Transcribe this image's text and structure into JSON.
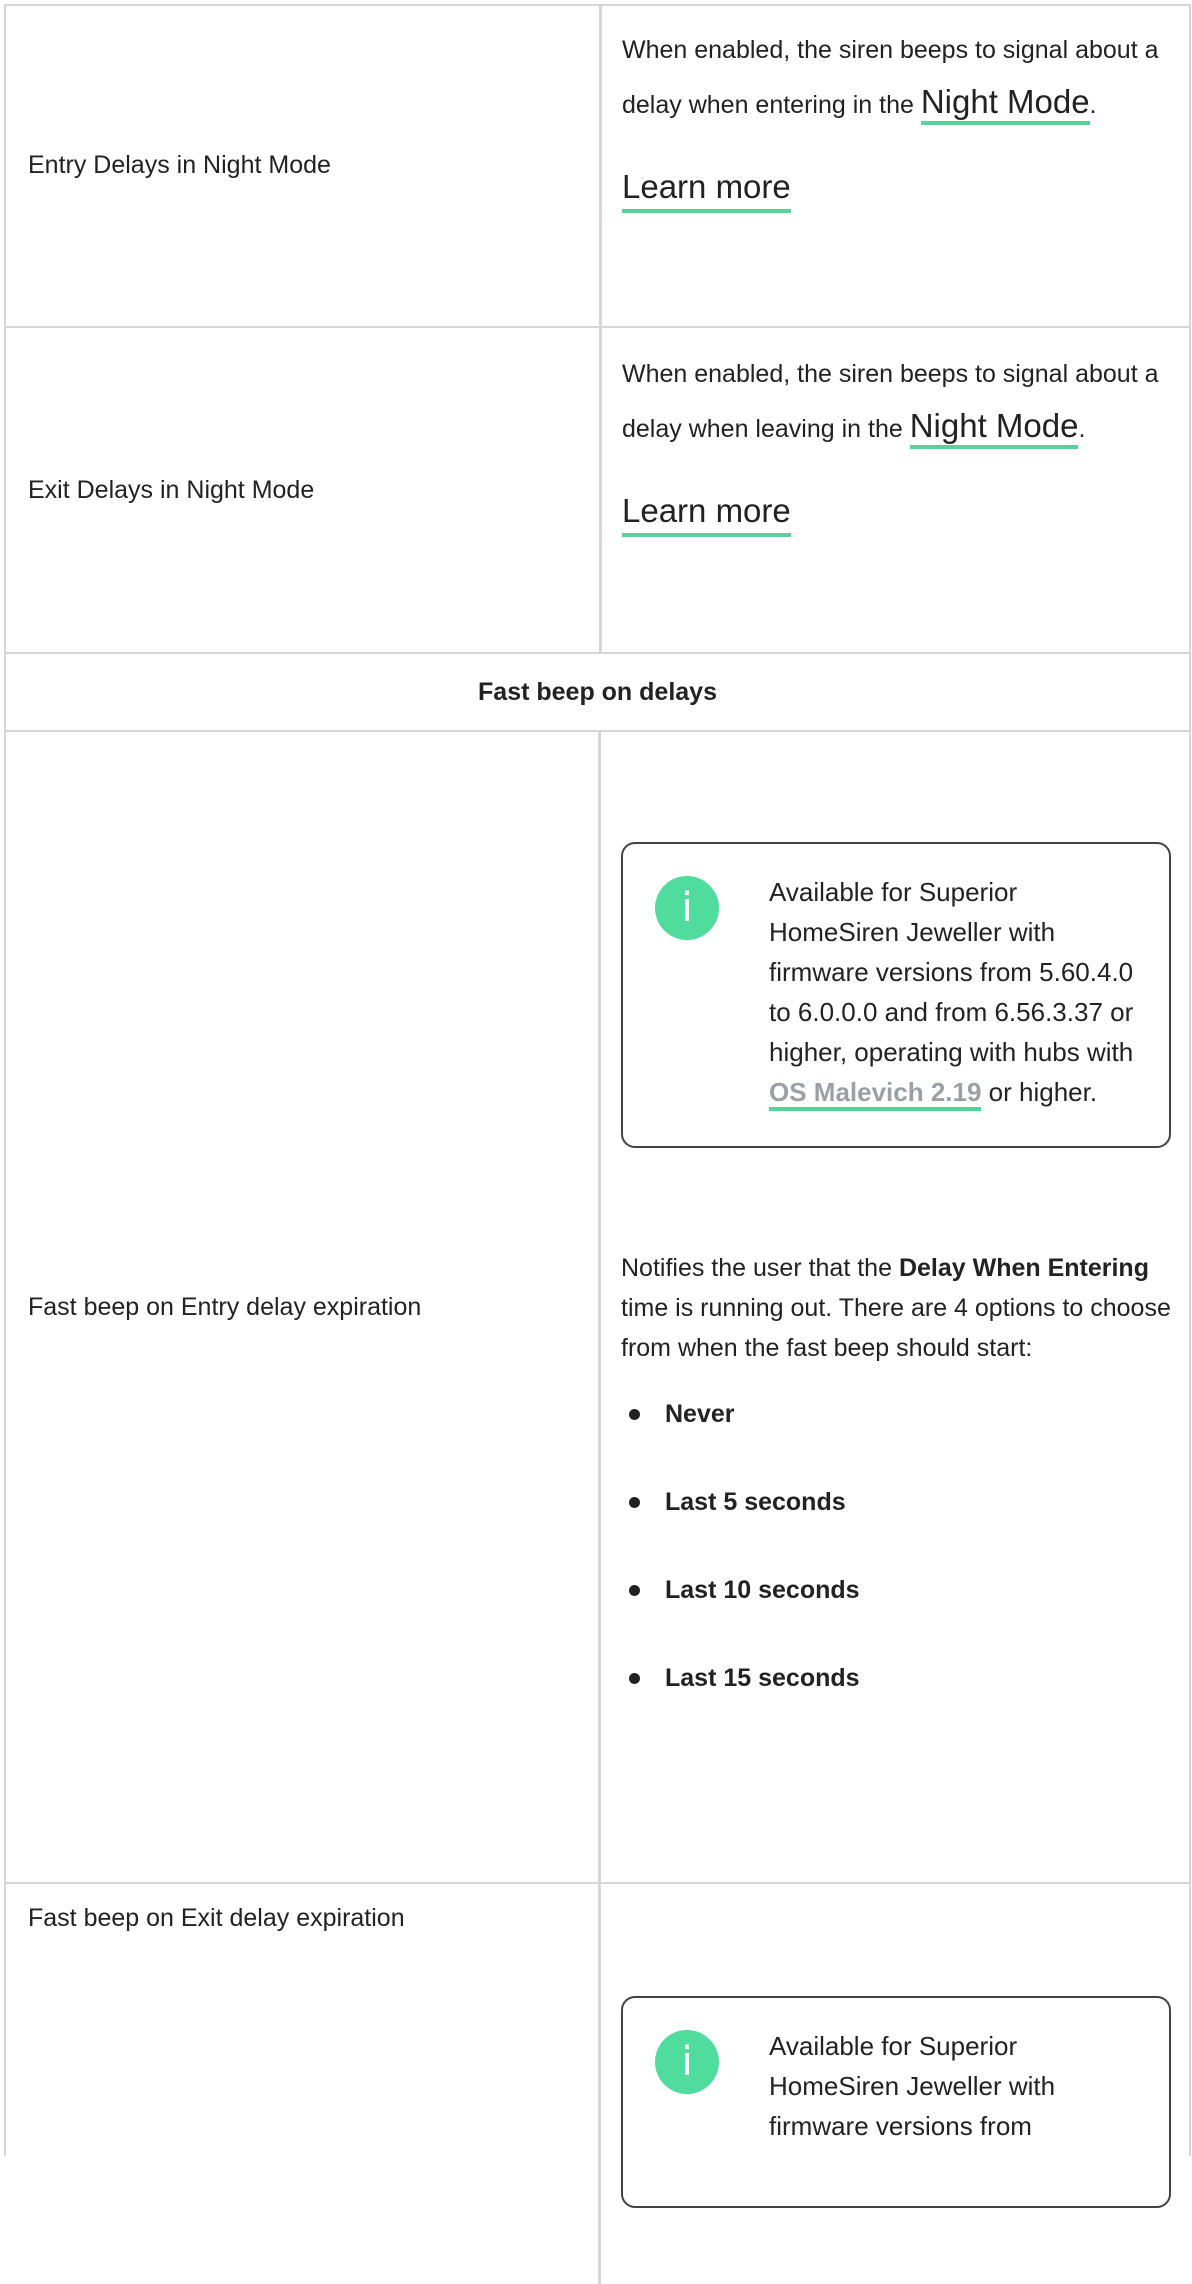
{
  "rows": [
    {
      "label": "Entry Delays in Night Mode",
      "desc_prefix": "When enabled, the siren beeps to signal about a delay when entering in the ",
      "link": "Night Mode",
      "desc_suffix": ".",
      "learn_more": "Learn more"
    },
    {
      "label": "Exit Delays in Night Mode",
      "desc_prefix": "When enabled, the siren beeps to signal about a delay when leaving in the ",
      "link": "Night Mode",
      "desc_suffix": ".",
      "learn_more": "Learn more"
    }
  ],
  "section_heading": "Fast beep on delays",
  "entry_row": {
    "label": "Fast beep on Entry delay expiration",
    "note": {
      "icon": "info-icon",
      "text_prefix": "Available for Superior HomeSiren Jeweller with firmware versions from 5.60.4.0 to 6.0.0.0 and from 6.56.3.37 or higher, operating with hubs with ",
      "link": "OS Malevich 2.19",
      "text_suffix": " or higher."
    },
    "desc_prefix": "Notifies the user that the ",
    "desc_bold": "Delay When Entering",
    "desc_suffix": " time is running out. There are 4 options to choose from when the fast beep should start:",
    "options": [
      "Never",
      "Last 5 seconds",
      "Last 10 seconds",
      "Last 15 seconds"
    ]
  },
  "exit_row": {
    "label": "Fast beep on Exit delay expiration",
    "note": {
      "icon": "info-icon",
      "text_prefix": "Available for Superior HomeSiren Jeweller with firmware versions from"
    }
  },
  "colors": {
    "accent": "#55d39a",
    "icon_bg": "#4fdc9c",
    "border": "#d6d6d6",
    "muted_link": "#9aa0a6"
  }
}
